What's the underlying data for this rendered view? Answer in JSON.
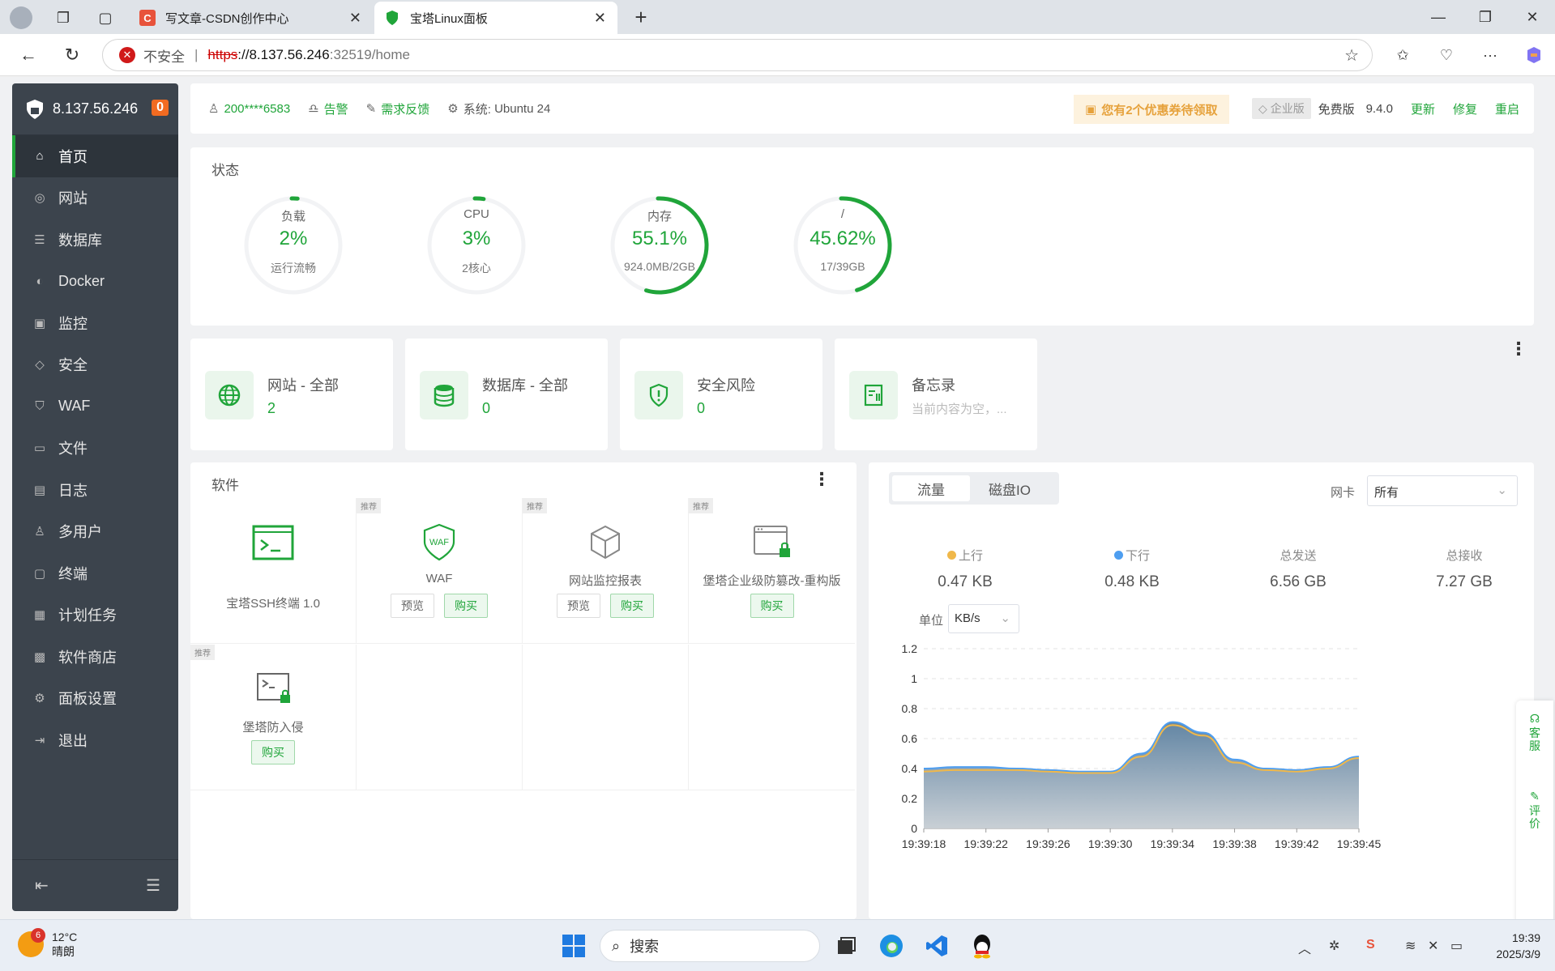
{
  "browser": {
    "tabs": [
      {
        "title": "写文章-CSDN创作中心",
        "favicon_text": "C",
        "favicon_color": "#e8533b"
      },
      {
        "title": "宝塔Linux面板",
        "favicon_text": "",
        "favicon_color": "#20a53a"
      }
    ],
    "url": {
      "insecure_label": "不安全",
      "proto": "https",
      "host": "://8.137.56.246",
      "port_path": ":32519/home"
    }
  },
  "sidebar": {
    "server_ip": "8.137.56.246",
    "badge": "0",
    "items": [
      {
        "label": "首页",
        "icon": "home-icon",
        "glyph": "⌂"
      },
      {
        "label": "网站",
        "icon": "globe-icon",
        "glyph": "◎"
      },
      {
        "label": "数据库",
        "icon": "database-icon",
        "glyph": "☰"
      },
      {
        "label": "Docker",
        "icon": "docker-icon",
        "glyph": "◐"
      },
      {
        "label": "监控",
        "icon": "monitor-icon",
        "glyph": "▣"
      },
      {
        "label": "安全",
        "icon": "shield-icon",
        "glyph": "◇"
      },
      {
        "label": "WAF",
        "icon": "waf-icon",
        "glyph": "⛉"
      },
      {
        "label": "文件",
        "icon": "folder-icon",
        "glyph": "▭"
      },
      {
        "label": "日志",
        "icon": "log-icon",
        "glyph": "▤"
      },
      {
        "label": "多用户",
        "icon": "users-icon",
        "glyph": "♙"
      },
      {
        "label": "终端",
        "icon": "terminal-icon",
        "glyph": "▢"
      },
      {
        "label": "计划任务",
        "icon": "calendar-icon",
        "glyph": "▦"
      },
      {
        "label": "软件商店",
        "icon": "apps-icon",
        "glyph": "▩"
      },
      {
        "label": "面板设置",
        "icon": "settings-icon",
        "glyph": "⚙"
      },
      {
        "label": "退出",
        "icon": "logout-icon",
        "glyph": "⇥"
      }
    ]
  },
  "header": {
    "user": "200****6583",
    "alarm": "告警",
    "feedback": "需求反馈",
    "system_label": "系统:",
    "system_value": "Ubuntu 24",
    "coupon": "您有2个优惠券待领取",
    "enterprise": "企业版",
    "free": "免费版",
    "version": "9.4.0",
    "update": "更新",
    "repair": "修复",
    "restart": "重启"
  },
  "status": {
    "title": "状态",
    "gauges": [
      {
        "label": "负载",
        "value": "2%",
        "sub": "运行流畅",
        "percent": 2
      },
      {
        "label": "CPU",
        "value": "3%",
        "sub": "2核心",
        "percent": 3
      },
      {
        "label": "内存",
        "value": "55.1%",
        "sub": "924.0MB/2GB",
        "percent": 55.1
      },
      {
        "label": "/",
        "value": "45.62%",
        "sub": "17/39GB",
        "percent": 45.62
      }
    ]
  },
  "overview": [
    {
      "title": "网站 - 全部",
      "value": "2"
    },
    {
      "title": "数据库 - 全部",
      "value": "0"
    },
    {
      "title": "安全风险",
      "value": "0"
    },
    {
      "title": "备忘录",
      "value": "当前内容为空，..."
    }
  ],
  "software": {
    "title": "软件",
    "tag": "推荐",
    "preview": "预览",
    "buy": "购买",
    "items": [
      {
        "name": "宝塔SSH终端 1.0"
      },
      {
        "name": "WAF"
      },
      {
        "name": "网站监控报表"
      },
      {
        "name": "堡塔企业级防篡改-重构版"
      },
      {
        "name": "堡塔防入侵"
      }
    ]
  },
  "traffic": {
    "tabs": [
      "流量",
      "磁盘IO"
    ],
    "nic_label": "网卡",
    "nic_value": "所有",
    "stats": [
      {
        "label": "上行",
        "value": "0.47 KB",
        "color": "#f0b84a"
      },
      {
        "label": "下行",
        "value": "0.48 KB",
        "color": "#4e9ef0"
      },
      {
        "label": "总发送",
        "value": "6.56 GB"
      },
      {
        "label": "总接收",
        "value": "7.27 GB"
      }
    ],
    "unit_label": "单位",
    "unit_value": "KB/s"
  },
  "chart_data": {
    "type": "area",
    "x": [
      "19:39:18",
      "19:39:20",
      "19:39:22",
      "19:39:24",
      "19:39:26",
      "19:39:28",
      "19:39:30",
      "19:39:32",
      "19:39:34",
      "19:39:36",
      "19:39:38",
      "19:39:40",
      "19:39:42",
      "19:39:44",
      "19:39:45"
    ],
    "x_ticks": [
      "19:39:18",
      "19:39:22",
      "19:39:26",
      "19:39:30",
      "19:39:34",
      "19:39:38",
      "19:39:42",
      "19:39:45"
    ],
    "series": [
      {
        "name": "上行",
        "color": "#f0b84a",
        "values": [
          0.38,
          0.39,
          0.39,
          0.39,
          0.38,
          0.37,
          0.37,
          0.48,
          0.69,
          0.62,
          0.44,
          0.39,
          0.38,
          0.4,
          0.47
        ]
      },
      {
        "name": "下行",
        "color": "#4e9ef0",
        "values": [
          0.4,
          0.41,
          0.41,
          0.4,
          0.39,
          0.38,
          0.38,
          0.5,
          0.71,
          0.64,
          0.46,
          0.4,
          0.39,
          0.41,
          0.48
        ]
      }
    ],
    "ylim": [
      0,
      1.2
    ],
    "y_ticks": [
      0,
      0.2,
      0.4,
      0.6,
      0.8,
      1,
      1.2
    ],
    "grid": true
  },
  "float_tools": {
    "service": "客服",
    "review": "评价"
  },
  "taskbar": {
    "weather_temp": "12°C",
    "weather_desc": "晴朗",
    "weather_badge": "6",
    "search": "搜索",
    "time": "19:39",
    "date": "2025/3/9"
  }
}
